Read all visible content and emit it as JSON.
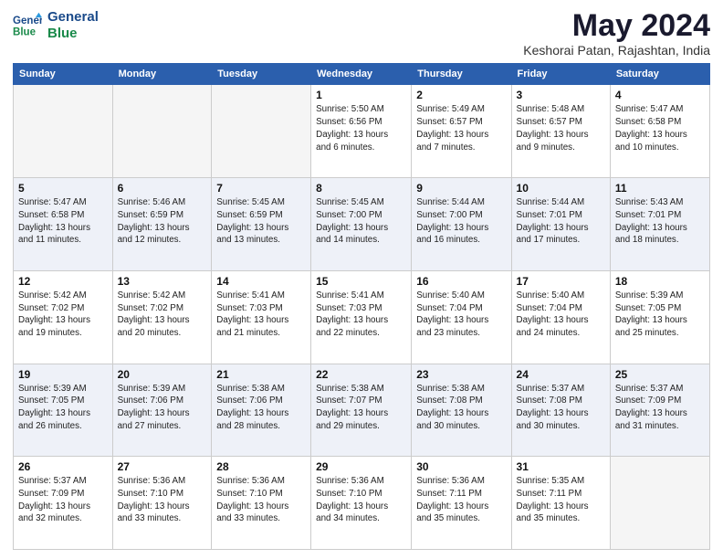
{
  "logo": {
    "text_general": "General",
    "text_blue": "Blue"
  },
  "header": {
    "month_year": "May 2024",
    "location": "Keshorai Patan, Rajashtan, India"
  },
  "weekdays": [
    "Sunday",
    "Monday",
    "Tuesday",
    "Wednesday",
    "Thursday",
    "Friday",
    "Saturday"
  ],
  "weeks": [
    [
      {
        "day": "",
        "info": ""
      },
      {
        "day": "",
        "info": ""
      },
      {
        "day": "",
        "info": ""
      },
      {
        "day": "1",
        "info": "Sunrise: 5:50 AM\nSunset: 6:56 PM\nDaylight: 13 hours\nand 6 minutes."
      },
      {
        "day": "2",
        "info": "Sunrise: 5:49 AM\nSunset: 6:57 PM\nDaylight: 13 hours\nand 7 minutes."
      },
      {
        "day": "3",
        "info": "Sunrise: 5:48 AM\nSunset: 6:57 PM\nDaylight: 13 hours\nand 9 minutes."
      },
      {
        "day": "4",
        "info": "Sunrise: 5:47 AM\nSunset: 6:58 PM\nDaylight: 13 hours\nand 10 minutes."
      }
    ],
    [
      {
        "day": "5",
        "info": "Sunrise: 5:47 AM\nSunset: 6:58 PM\nDaylight: 13 hours\nand 11 minutes."
      },
      {
        "day": "6",
        "info": "Sunrise: 5:46 AM\nSunset: 6:59 PM\nDaylight: 13 hours\nand 12 minutes."
      },
      {
        "day": "7",
        "info": "Sunrise: 5:45 AM\nSunset: 6:59 PM\nDaylight: 13 hours\nand 13 minutes."
      },
      {
        "day": "8",
        "info": "Sunrise: 5:45 AM\nSunset: 7:00 PM\nDaylight: 13 hours\nand 14 minutes."
      },
      {
        "day": "9",
        "info": "Sunrise: 5:44 AM\nSunset: 7:00 PM\nDaylight: 13 hours\nand 16 minutes."
      },
      {
        "day": "10",
        "info": "Sunrise: 5:44 AM\nSunset: 7:01 PM\nDaylight: 13 hours\nand 17 minutes."
      },
      {
        "day": "11",
        "info": "Sunrise: 5:43 AM\nSunset: 7:01 PM\nDaylight: 13 hours\nand 18 minutes."
      }
    ],
    [
      {
        "day": "12",
        "info": "Sunrise: 5:42 AM\nSunset: 7:02 PM\nDaylight: 13 hours\nand 19 minutes."
      },
      {
        "day": "13",
        "info": "Sunrise: 5:42 AM\nSunset: 7:02 PM\nDaylight: 13 hours\nand 20 minutes."
      },
      {
        "day": "14",
        "info": "Sunrise: 5:41 AM\nSunset: 7:03 PM\nDaylight: 13 hours\nand 21 minutes."
      },
      {
        "day": "15",
        "info": "Sunrise: 5:41 AM\nSunset: 7:03 PM\nDaylight: 13 hours\nand 22 minutes."
      },
      {
        "day": "16",
        "info": "Sunrise: 5:40 AM\nSunset: 7:04 PM\nDaylight: 13 hours\nand 23 minutes."
      },
      {
        "day": "17",
        "info": "Sunrise: 5:40 AM\nSunset: 7:04 PM\nDaylight: 13 hours\nand 24 minutes."
      },
      {
        "day": "18",
        "info": "Sunrise: 5:39 AM\nSunset: 7:05 PM\nDaylight: 13 hours\nand 25 minutes."
      }
    ],
    [
      {
        "day": "19",
        "info": "Sunrise: 5:39 AM\nSunset: 7:05 PM\nDaylight: 13 hours\nand 26 minutes."
      },
      {
        "day": "20",
        "info": "Sunrise: 5:39 AM\nSunset: 7:06 PM\nDaylight: 13 hours\nand 27 minutes."
      },
      {
        "day": "21",
        "info": "Sunrise: 5:38 AM\nSunset: 7:06 PM\nDaylight: 13 hours\nand 28 minutes."
      },
      {
        "day": "22",
        "info": "Sunrise: 5:38 AM\nSunset: 7:07 PM\nDaylight: 13 hours\nand 29 minutes."
      },
      {
        "day": "23",
        "info": "Sunrise: 5:38 AM\nSunset: 7:08 PM\nDaylight: 13 hours\nand 30 minutes."
      },
      {
        "day": "24",
        "info": "Sunrise: 5:37 AM\nSunset: 7:08 PM\nDaylight: 13 hours\nand 30 minutes."
      },
      {
        "day": "25",
        "info": "Sunrise: 5:37 AM\nSunset: 7:09 PM\nDaylight: 13 hours\nand 31 minutes."
      }
    ],
    [
      {
        "day": "26",
        "info": "Sunrise: 5:37 AM\nSunset: 7:09 PM\nDaylight: 13 hours\nand 32 minutes."
      },
      {
        "day": "27",
        "info": "Sunrise: 5:36 AM\nSunset: 7:10 PM\nDaylight: 13 hours\nand 33 minutes."
      },
      {
        "day": "28",
        "info": "Sunrise: 5:36 AM\nSunset: 7:10 PM\nDaylight: 13 hours\nand 33 minutes."
      },
      {
        "day": "29",
        "info": "Sunrise: 5:36 AM\nSunset: 7:10 PM\nDaylight: 13 hours\nand 34 minutes."
      },
      {
        "day": "30",
        "info": "Sunrise: 5:36 AM\nSunset: 7:11 PM\nDaylight: 13 hours\nand 35 minutes."
      },
      {
        "day": "31",
        "info": "Sunrise: 5:35 AM\nSunset: 7:11 PM\nDaylight: 13 hours\nand 35 minutes."
      },
      {
        "day": "",
        "info": ""
      }
    ]
  ]
}
